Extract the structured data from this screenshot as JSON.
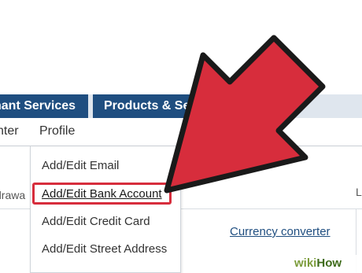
{
  "tabs": {
    "merchant_services": "nant Services",
    "products_services": "Products & Ser"
  },
  "subnav": {
    "center": "nter",
    "profile": "Profile"
  },
  "profile_menu": {
    "items": [
      "Add/Edit Email",
      "Add/Edit Bank Account",
      "Add/Edit Credit Card",
      "Add/Edit Street Address"
    ],
    "highlighted_index": 1
  },
  "background": {
    "left_fragment": "drawa",
    "right_fragment": "L",
    "currency_link": "Currency converter"
  },
  "annotation": {
    "arrow_color": "#d72d3c",
    "highlight_color": "#d72d3c"
  },
  "watermark": {
    "part1": "wiki",
    "part2": "How"
  }
}
